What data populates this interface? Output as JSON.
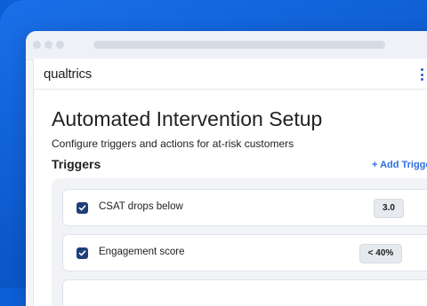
{
  "app": {
    "brand": "qualtrics"
  },
  "page": {
    "title": "Automated Intervention Setup",
    "subtitle": "Configure triggers and actions for at-risk customers"
  },
  "triggers": {
    "heading": "Triggers",
    "add_label": "+ Add Trigger",
    "items": [
      {
        "label": "CSAT drops below",
        "value": "3.0",
        "checked": true
      },
      {
        "label": "Engagement score",
        "value": "< 40%",
        "checked": true
      }
    ]
  },
  "colors": {
    "accent": "#2f6fe0",
    "checkbox": "#1f3f7a",
    "background": "#0d5fd6"
  }
}
